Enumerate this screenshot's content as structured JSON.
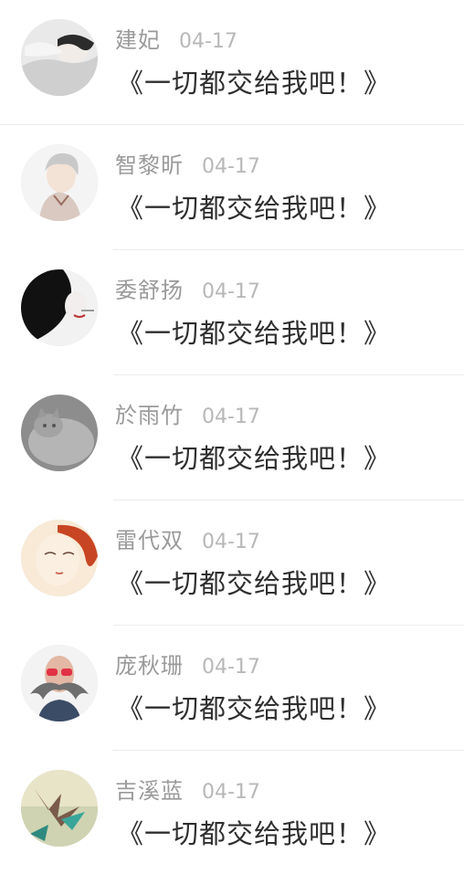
{
  "comments": [
    {
      "name": "建妃",
      "date": "04-17",
      "text": "《一切都交给我吧！》",
      "avatar": "woman-lying-avatar"
    },
    {
      "name": "智黎昕",
      "date": "04-17",
      "text": "《一切都交给我吧！》",
      "avatar": "anime-boy-avatar"
    },
    {
      "name": "委舒扬",
      "date": "04-17",
      "text": "《一切都交给我吧！》",
      "avatar": "black-hair-woman-avatar"
    },
    {
      "name": "於雨竹",
      "date": "04-17",
      "text": "《一切都交给我吧！》",
      "avatar": "grey-cat-avatar"
    },
    {
      "name": "雷代双",
      "date": "04-17",
      "text": "《一切都交给我吧！》",
      "avatar": "red-hair-girl-avatar"
    },
    {
      "name": "庞秋珊",
      "date": "04-17",
      "text": "《一切都交给我吧！》",
      "avatar": "mustache-man-avatar"
    },
    {
      "name": "吉溪蓝",
      "date": "04-17",
      "text": "《一切都交给我吧！》",
      "avatar": "paper-crane-avatar"
    }
  ],
  "colors": {
    "name": "#9a9a9a",
    "date": "#b8b8b8",
    "message": "#2f2f2f",
    "divider": "#ececec"
  }
}
